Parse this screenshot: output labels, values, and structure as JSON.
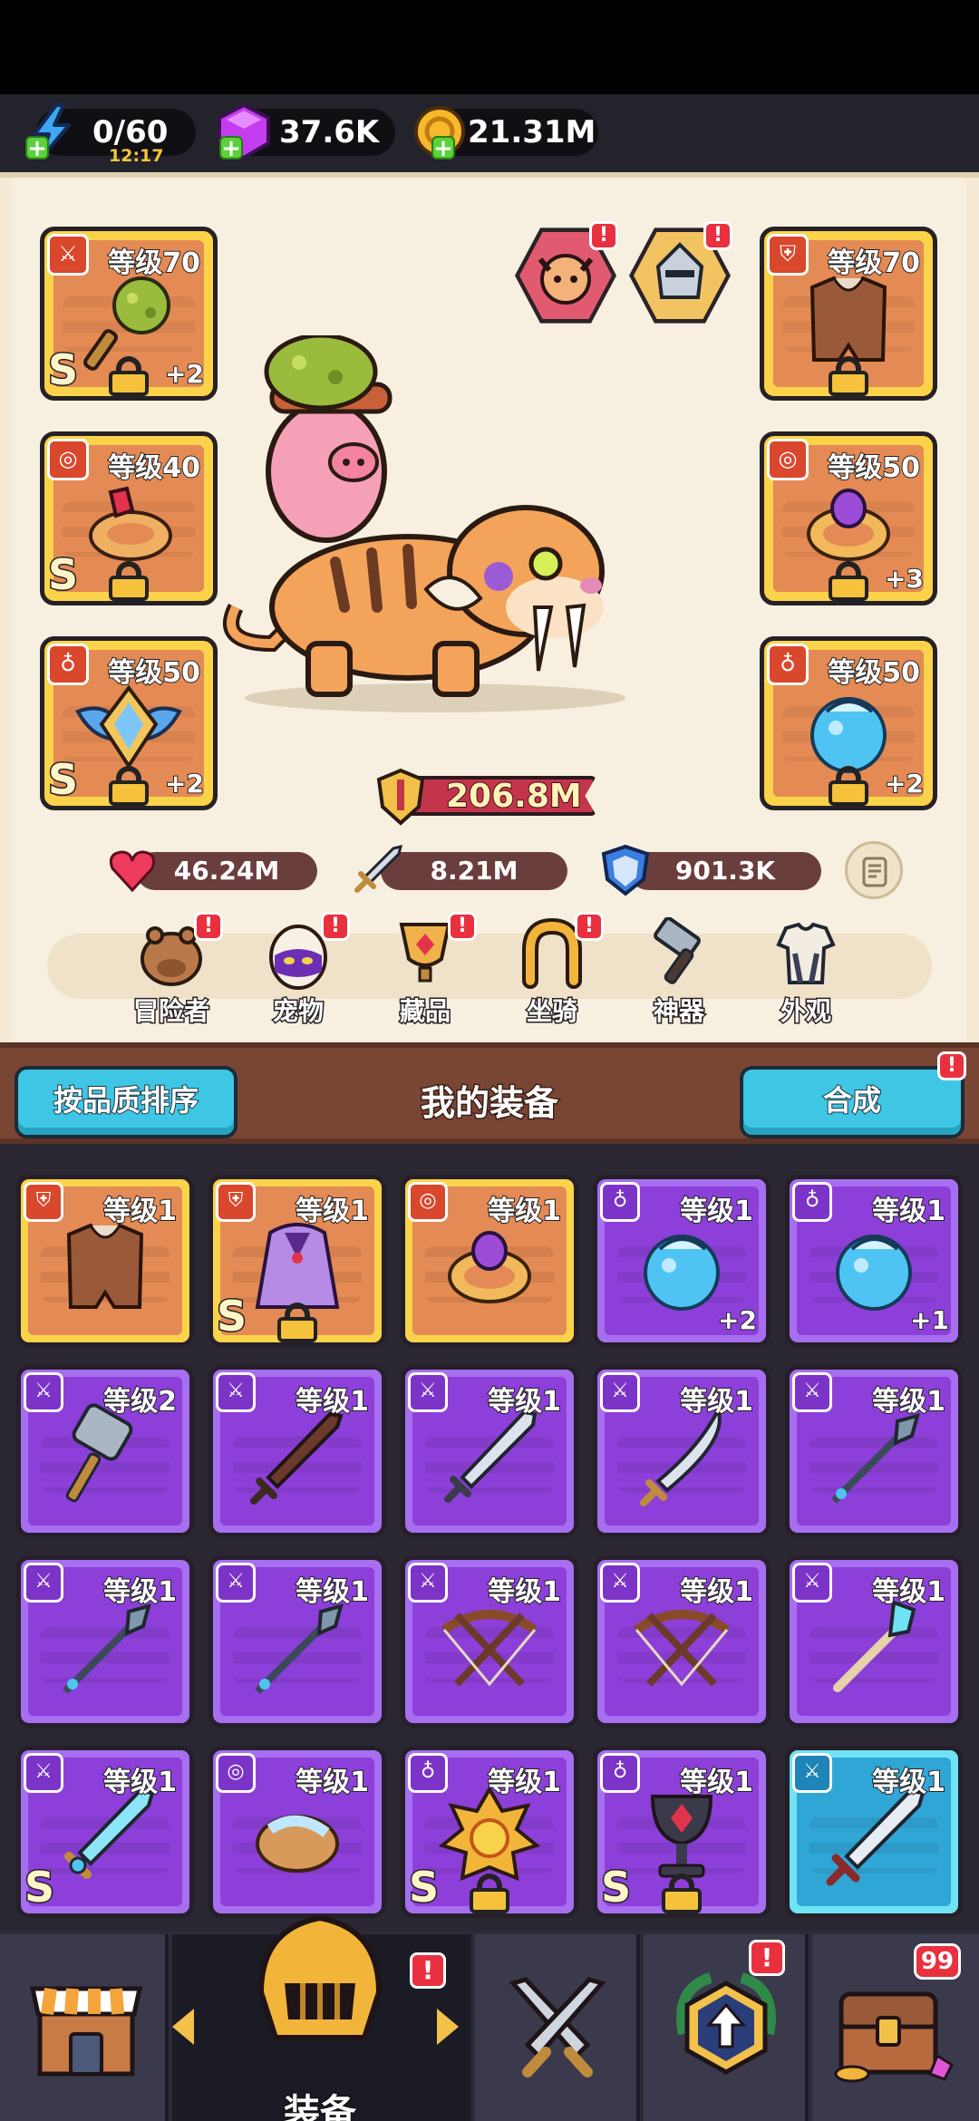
{
  "resources": {
    "energy": {
      "value": "0/60",
      "timer": "12:17",
      "icon": "lightning-icon"
    },
    "gems": {
      "value": "37.6K",
      "icon": "gem-icon"
    },
    "coins": {
      "value": "21.31M",
      "icon": "coin-icon"
    }
  },
  "equipped": {
    "weapon": {
      "level": "等级70",
      "plus": "+2",
      "rank": "S",
      "icon": "spiked-mace-icon"
    },
    "ring": {
      "level": "等级40",
      "plus": "",
      "rank": "S",
      "icon": "ruby-bracelet-icon"
    },
    "amulet": {
      "level": "等级50",
      "plus": "+2",
      "rank": "S",
      "icon": "winged-emblem-icon"
    },
    "armor": {
      "level": "等级70",
      "plus": "",
      "rank": "",
      "icon": "leather-armor-icon"
    },
    "bracelet": {
      "level": "等级50",
      "plus": "+3",
      "rank": "",
      "icon": "amethyst-ring-icon"
    },
    "orb": {
      "level": "等级50",
      "plus": "+2",
      "rank": "",
      "icon": "water-orb-icon"
    }
  },
  "power": "206.8M",
  "stats": {
    "hp": "46.24M",
    "attack": "8.21M",
    "defense": "901.3K"
  },
  "tabs": [
    {
      "label": "冒险者",
      "notify": "!"
    },
    {
      "label": "宠物",
      "notify": "!"
    },
    {
      "label": "藏品",
      "notify": "!"
    },
    {
      "label": "坐骑",
      "notify": "!"
    },
    {
      "label": "神器",
      "notify": ""
    },
    {
      "label": "外观",
      "notify": ""
    }
  ],
  "toolbar": {
    "sort_label": "按品质排序",
    "title": "我的装备",
    "merge_label": "合成",
    "merge_notify": "!"
  },
  "inventory": [
    {
      "level": "等级1",
      "quality": "orange",
      "plus": "",
      "rank": "",
      "locked": false,
      "icon": "leather-armor-icon"
    },
    {
      "level": "等级1",
      "quality": "orange",
      "plus": "",
      "rank": "S",
      "locked": true,
      "icon": "purple-cloak-icon"
    },
    {
      "level": "等级1",
      "quality": "orange",
      "plus": "",
      "rank": "",
      "locked": false,
      "icon": "amethyst-ring-icon"
    },
    {
      "level": "等级1",
      "quality": "purple",
      "plus": "+2",
      "rank": "",
      "locked": false,
      "icon": "water-orb-icon"
    },
    {
      "level": "等级1",
      "quality": "purple",
      "plus": "+1",
      "rank": "",
      "locked": false,
      "icon": "water-orb-icon"
    },
    {
      "level": "等级2",
      "quality": "purple",
      "plus": "",
      "rank": "",
      "locked": false,
      "icon": "hammer-icon"
    },
    {
      "level": "等级1",
      "quality": "purple",
      "plus": "",
      "rank": "",
      "locked": false,
      "icon": "wooden-sword-icon"
    },
    {
      "level": "等级1",
      "quality": "purple",
      "plus": "",
      "rank": "",
      "locked": false,
      "icon": "steel-sword-icon"
    },
    {
      "level": "等级1",
      "quality": "purple",
      "plus": "",
      "rank": "",
      "locked": false,
      "icon": "scimitar-icon"
    },
    {
      "level": "等级1",
      "quality": "purple",
      "plus": "",
      "rank": "",
      "locked": false,
      "icon": "spear-icon"
    },
    {
      "level": "等级1",
      "quality": "purple",
      "plus": "",
      "rank": "",
      "locked": false,
      "icon": "spear-icon"
    },
    {
      "level": "等级1",
      "quality": "purple",
      "plus": "",
      "rank": "",
      "locked": false,
      "icon": "spear-icon"
    },
    {
      "level": "等级1",
      "quality": "purple",
      "plus": "",
      "rank": "",
      "locked": false,
      "icon": "crossbow-icon"
    },
    {
      "level": "等级1",
      "quality": "purple",
      "plus": "",
      "rank": "",
      "locked": false,
      "icon": "crossbow-icon"
    },
    {
      "level": "等级1",
      "quality": "purple",
      "plus": "",
      "rank": "",
      "locked": false,
      "icon": "crystal-staff-icon"
    },
    {
      "level": "等级1",
      "quality": "purple",
      "plus": "",
      "rank": "S",
      "locked": false,
      "icon": "ice-sword-icon"
    },
    {
      "level": "等级1",
      "quality": "purple",
      "plus": "",
      "rank": "",
      "locked": false,
      "icon": "feather-bracelet-icon"
    },
    {
      "level": "等级1",
      "quality": "purple",
      "plus": "",
      "rank": "S",
      "locked": true,
      "icon": "sun-medallion-icon"
    },
    {
      "level": "等级1",
      "quality": "purple",
      "plus": "",
      "rank": "S",
      "locked": true,
      "icon": "chalice-icon"
    },
    {
      "level": "等级1",
      "quality": "blue",
      "plus": "",
      "rank": "",
      "locked": false,
      "icon": "broadsword-icon"
    }
  ],
  "nav": {
    "shop": {
      "icon": "shop-icon"
    },
    "equipment": {
      "label": "装备",
      "icon": "helmet-icon",
      "notify": "!"
    },
    "battle": {
      "icon": "crossed-swords-icon"
    },
    "upgrade": {
      "icon": "upgrade-emblem-icon",
      "notify": "!"
    },
    "chest": {
      "icon": "treasure-chest-icon",
      "count": "99"
    }
  },
  "colors": {
    "orange_frame": "#fbd34a",
    "purple_frame": "#a76ef0",
    "blue_frame": "#6fe2f4",
    "notify": "#e9303f",
    "button_blue": "#3ec6e4"
  }
}
